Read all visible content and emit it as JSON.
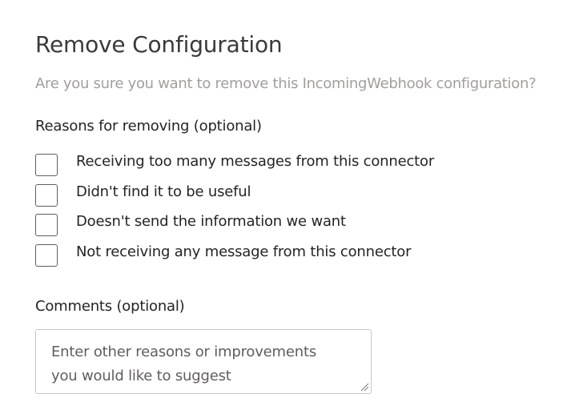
{
  "dialog": {
    "title": "Remove Configuration",
    "subtitle": "Are you sure you want to remove this IncomingWebhook configuration?"
  },
  "reasons": {
    "label": "Reasons for removing (optional)",
    "options": [
      {
        "label": "Receiving too many messages from this connector",
        "checked": false
      },
      {
        "label": "Didn't find it to be useful",
        "checked": false
      },
      {
        "label": "Doesn't send the information we want",
        "checked": false
      },
      {
        "label": "Not receiving any message from this connector",
        "checked": false
      }
    ]
  },
  "comments": {
    "label": "Comments (optional)",
    "placeholder": "Enter other reasons or improvements you would like to suggest",
    "value": ""
  },
  "icons": {
    "resize": "resize-grip-icon"
  }
}
